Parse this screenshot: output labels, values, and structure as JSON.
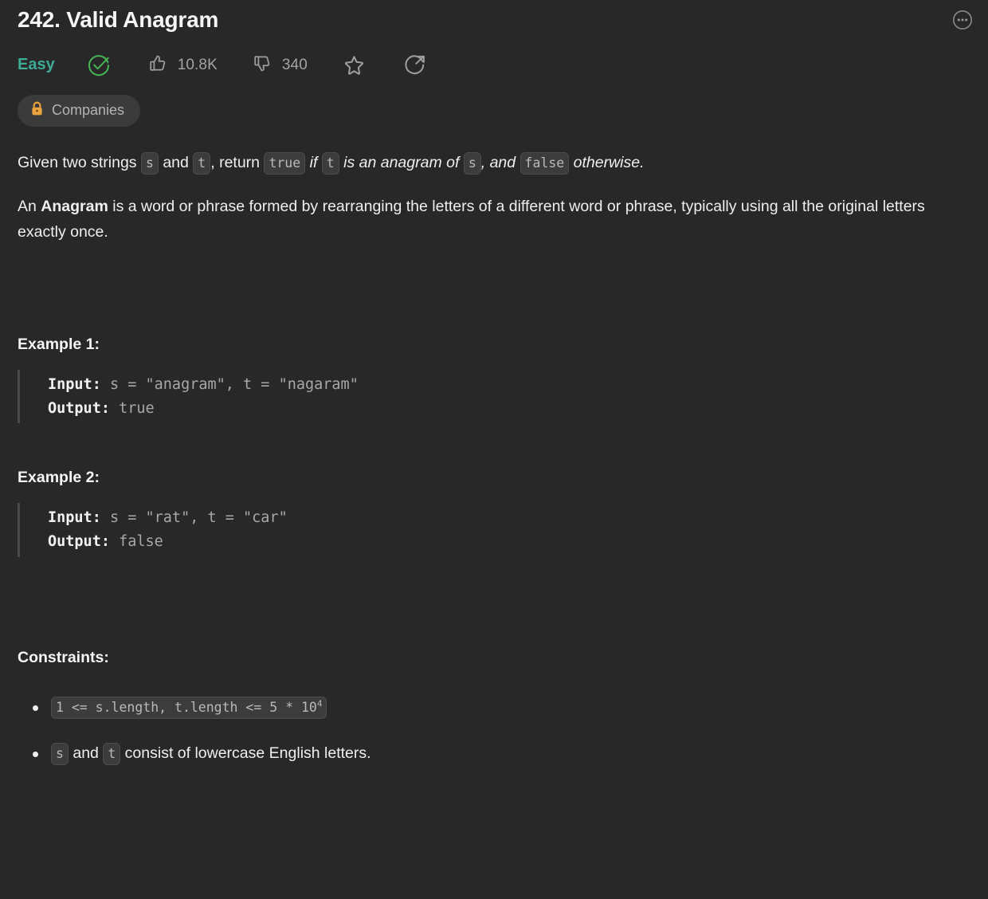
{
  "header": {
    "title": "242. Valid Anagram",
    "more_icon": "more-options-icon",
    "difficulty": "Easy",
    "solved_icon": "check-circle-icon",
    "likes_icon": "thumbs-up-icon",
    "likes": "10.8K",
    "dislikes_icon": "thumbs-down-icon",
    "dislikes": "340",
    "star_icon": "star-icon",
    "share_icon": "share-icon"
  },
  "badge": {
    "lock_icon": "lock-icon",
    "label": "Companies"
  },
  "description": {
    "p1": {
      "t1": "Given two strings ",
      "code_s": "s",
      "t2": " and ",
      "code_t": "t",
      "t3": ", return ",
      "code_true": "true",
      "t4": " if ",
      "code_t2": "t",
      "t5": " is an anagram of ",
      "code_s2": "s",
      "t6": ", and ",
      "code_false": "false",
      "t7": " otherwise."
    },
    "p2": {
      "t1": "An ",
      "bold": "Anagram",
      "t2": " is a word or phrase formed by rearranging the letters of a different word or phrase, typically using all the original letters exactly once."
    }
  },
  "examples": [
    {
      "heading": "Example 1:",
      "input_label": "Input:",
      "input_value": " s = \"anagram\", t = \"nagaram\"",
      "output_label": "Output:",
      "output_value": " true"
    },
    {
      "heading": "Example 2:",
      "input_label": "Input:",
      "input_value": " s = \"rat\", t = \"car\"",
      "output_label": "Output:",
      "output_value": " false"
    }
  ],
  "constraints": {
    "heading": "Constraints:",
    "item1": {
      "code_base": "1 <= s.length, t.length <= 5 * 10",
      "code_sup": "4"
    },
    "item2": {
      "code_s": "s",
      "t1": " and ",
      "code_t": "t",
      "t2": " consist of lowercase English letters."
    }
  },
  "colors": {
    "background": "#282828",
    "difficulty_easy": "#3dab96",
    "solved_green": "#45b653",
    "lock_amber": "#eaa33e",
    "chip_bg": "#3c3c3c",
    "muted_text": "#a3a3a3"
  }
}
